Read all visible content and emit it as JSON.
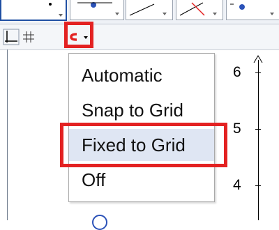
{
  "menu": {
    "items": [
      {
        "label": "Automatic"
      },
      {
        "label": "Snap to Grid"
      },
      {
        "label": "Fixed to Grid",
        "selected": true
      },
      {
        "label": "Off"
      }
    ]
  },
  "axis": {
    "y_ticks": [
      "6",
      "5",
      "4"
    ]
  },
  "icons": {
    "toolbar": [
      "point-tool-icon",
      "line-tool-icon",
      "segment-tool-icon",
      "angle-tool-icon",
      "point-on-object-icon"
    ],
    "stylebar": [
      "axes-toggle-icon",
      "grid-toggle-icon",
      "point-capturing-icon",
      "dropdown-arrow-icon"
    ]
  },
  "colors": {
    "highlight": "#e32222",
    "selected_item_bg": "#dfe6f3",
    "magnet": "#e32222"
  }
}
